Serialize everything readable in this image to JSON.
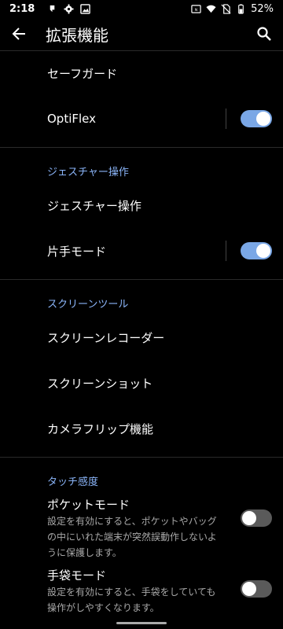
{
  "status_bar": {
    "time": "2:18",
    "battery": "52%",
    "left_icons": [
      "notification-icon",
      "settings-gear-icon",
      "image-icon"
    ],
    "right_icons": [
      "nfc-icon",
      "wifi-icon",
      "no-sim-icon",
      "battery-icon"
    ]
  },
  "app_bar": {
    "title": "拡張機能"
  },
  "items": {
    "safeguard": "セーフガード",
    "optiflex": "OptiFlex",
    "gesture_header": "ジェスチャー操作",
    "gesture": "ジェスチャー操作",
    "one_hand": "片手モード",
    "screen_tools_header": "スクリーンツール",
    "screen_recorder": "スクリーンレコーダー",
    "screenshot": "スクリーンショット",
    "camera_flip": "カメラフリップ機能",
    "touch_header": "タッチ感度",
    "pocket_mode": "ポケットモード",
    "pocket_desc": "設定を有効にすると、ポケットやバッグの中にいれた端末が突然誤動作しないように保護します。",
    "glove_mode": "手袋モード",
    "glove_desc": "設定を有効にすると、手袋をしていても操作がしやすくなります。"
  },
  "toggles": {
    "optiflex": true,
    "one_hand": true,
    "pocket_mode": false,
    "glove_mode": false
  },
  "colors": {
    "accent": "#8ab4f8",
    "toggle_on": "#7aa7e6",
    "toggle_off": "#5a5a5a",
    "background": "#000000"
  }
}
